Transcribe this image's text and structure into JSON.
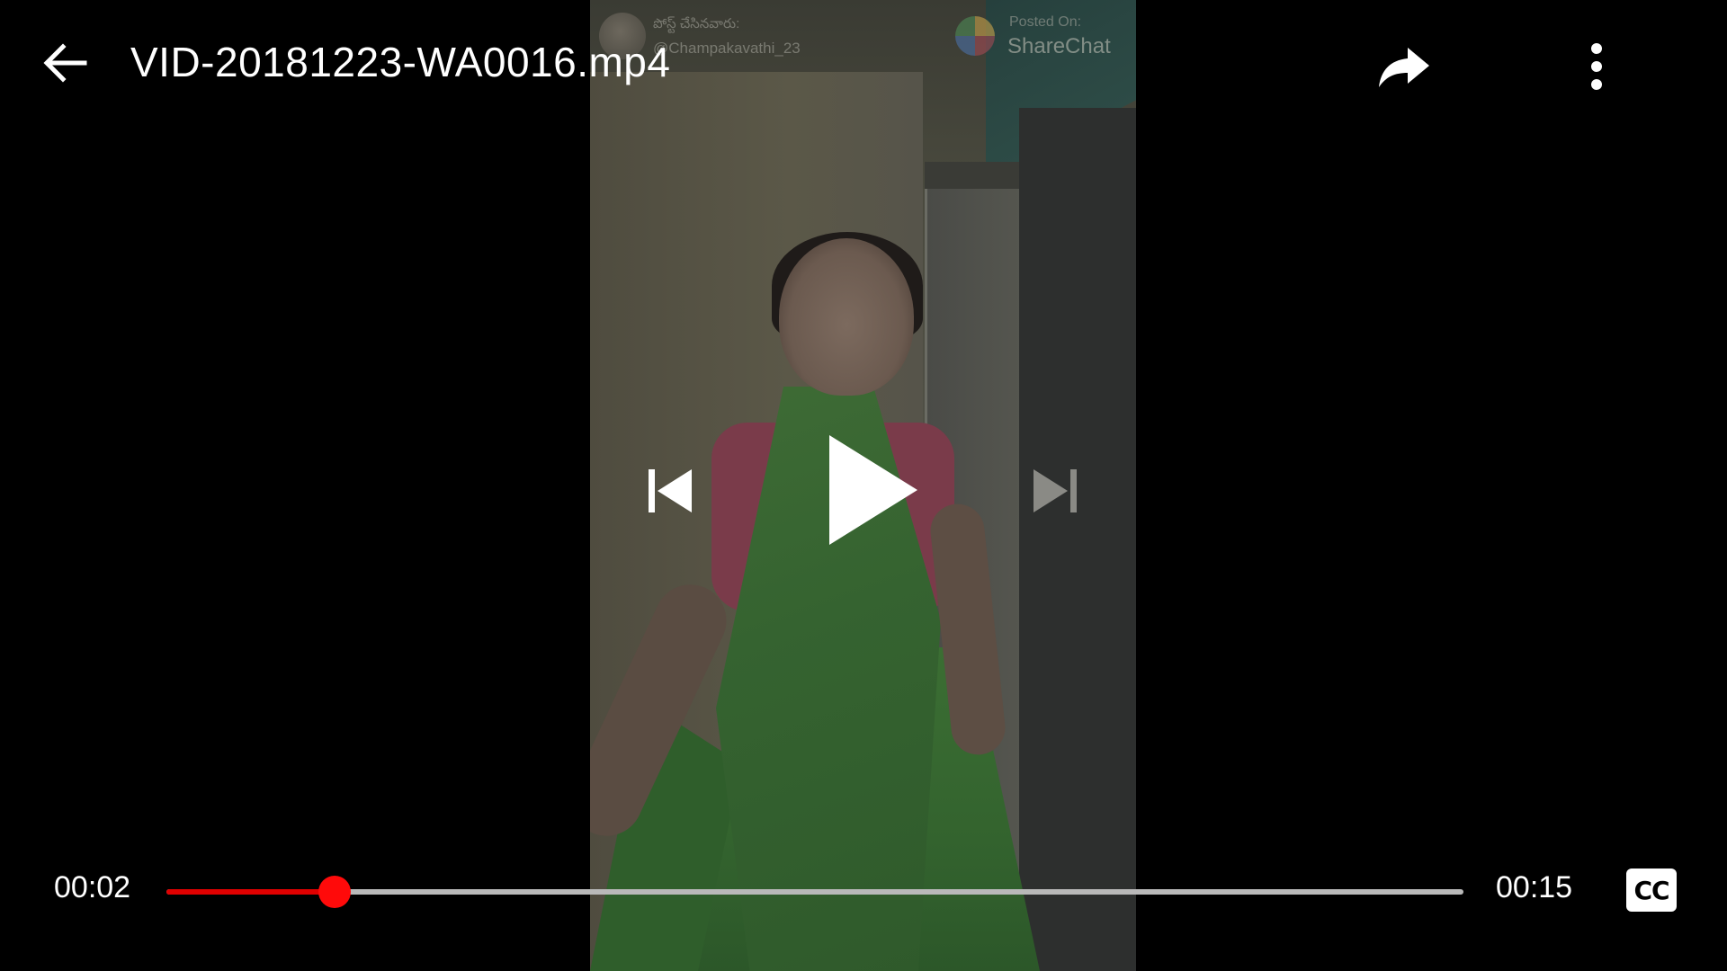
{
  "header": {
    "title": "VID-20181223-WA0016.mp4",
    "icons": {
      "back": "arrow-left-icon",
      "share": "share-arrow-icon",
      "more": "more-vert-icon"
    }
  },
  "video": {
    "watermark": {
      "posted_by": "పోస్ట్ చేసినవారు:",
      "username": "@Champakavathi_23",
      "posted_on": "Posted On:",
      "brand": "ShareChat"
    }
  },
  "controls": {
    "icons": {
      "previous": "skip-previous-icon",
      "play": "play-icon",
      "next": "skip-next-icon",
      "captions": "closed-captions-icon"
    },
    "captions_label": "CC"
  },
  "playback": {
    "current_time": "00:02",
    "total_time": "00:15",
    "progress": 0.13
  },
  "colors": {
    "accent": "#e00000",
    "track": "#b9b9b9",
    "background": "#000000",
    "foreground": "#ffffff"
  }
}
